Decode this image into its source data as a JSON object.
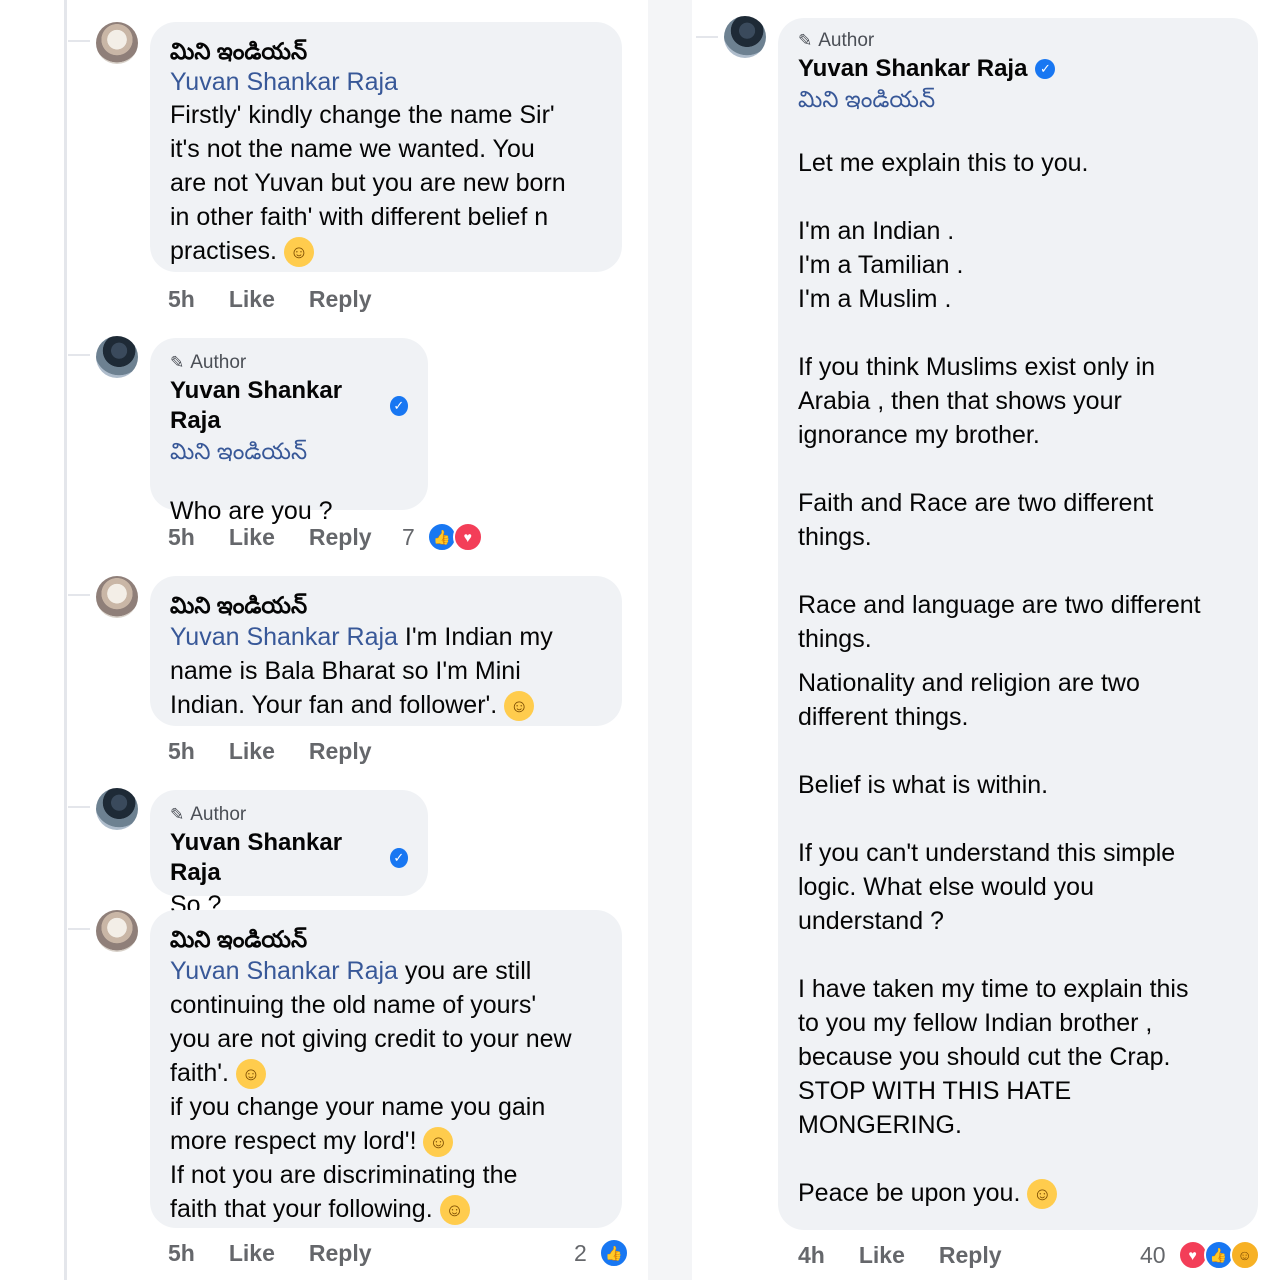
{
  "left": {
    "comments": [
      {
        "author": "మిని ఇండియన్",
        "mention": "Yuvan Shankar Raja",
        "text": " Firstly' kindly change the name Sir'\nit's not the name we wanted. You\nare not Yuvan but you are new born\nin other faith' with different belief n\npractises.",
        "emoji": "hug-emoji",
        "time": "5h",
        "like": "Like",
        "reply": "Reply"
      },
      {
        "author_tag": "Author",
        "author": "Yuvan Shankar Raja",
        "mention": "మిని ఇండియన్",
        "text": "Who are you ?",
        "time": "5h",
        "like": "Like",
        "reply": "Reply",
        "reaction_count": "7"
      },
      {
        "author": "మిని ఇండియన్",
        "mention": "Yuvan Shankar Raja",
        "text": " I'm Indian my\nname is Bala Bharat  so I'm Mini\nIndian.  Your fan and follower'.",
        "emoji": "grin-emoji",
        "time": "5h",
        "like": "Like",
        "reply": "Reply"
      },
      {
        "author_tag": "Author",
        "author": "Yuvan Shankar Raja",
        "text": "So ?"
      },
      {
        "author": "మిని ఇండియన్",
        "mention": "Yuvan Shankar Raja",
        "text_a": "  you are still\ncontinuing the old name of yours'\nyou are not giving credit to your new\nfaith'.",
        "text_b": " if you change your name you gain\nmore respect my lord'!",
        "text_c": "If not you are discriminating the\nfaith that your following.",
        "time": "5h",
        "like": "Like",
        "reply": "Reply",
        "reaction_count": "2"
      }
    ]
  },
  "right": {
    "author_tag": "Author",
    "author": "Yuvan Shankar Raja",
    "mention": "మిని ఇండియన్",
    "paragraphs": [
      "Let me explain this to you.",
      "I'm an Indian .\nI'm a Tamilian .\nI'm a Muslim .",
      "If you think Muslims exist only in\nArabia , then that shows your\nignorance my brother.",
      "Faith and Race are two different\nthings.",
      "Race and language are two different\nthings.",
      "Nationality and religion are two\ndifferent things.",
      "Belief is what is within.",
      "If you can't understand this simple\nlogic. What else would you\nunderstand ?",
      "I have taken my time to explain this\nto you my fellow Indian brother ,\nbecause you should cut the Crap.\nSTOP WITH THIS HATE\nMONGERING.",
      "Peace be upon you."
    ],
    "time": "4h",
    "like": "Like",
    "reply": "Reply",
    "reaction_count": "40"
  }
}
